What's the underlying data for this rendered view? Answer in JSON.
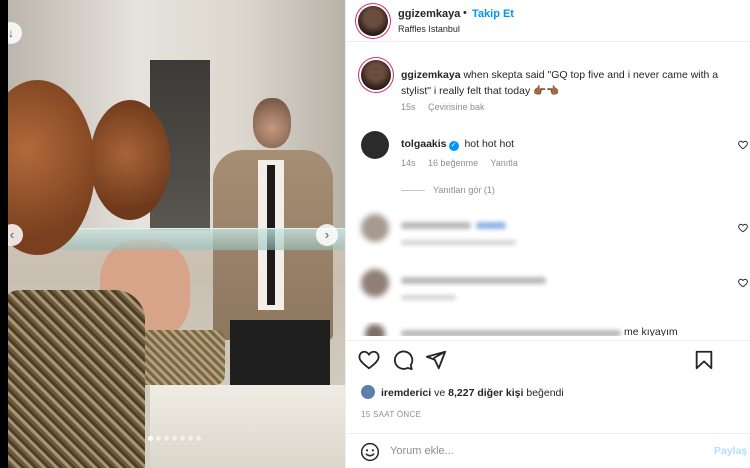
{
  "post": {
    "author": "ggizemkaya",
    "follow_label": "Takip Et",
    "separator": "•",
    "location": "Raffles Istanbul",
    "carousel": {
      "dots_total": 7,
      "active_index": 0
    }
  },
  "caption": {
    "author": "ggizemkaya",
    "text": "when skepta said \"GQ top five and i never came with a stylist\" i really felt that today 👉🏾👈🏾",
    "time": "15s",
    "translate_label": "Çevirisine bak"
  },
  "comments": [
    {
      "author": "tolgaakis",
      "verified": true,
      "text": "hot hot hot",
      "time": "14s",
      "likes": "16 beğenme",
      "reply_label": "Yanıtla",
      "view_replies": "Yanıtları gör (1)"
    }
  ],
  "partial_comment_tail": "me kıyayım",
  "likes": {
    "liker": "iremderici",
    "connector": "ve",
    "others": "8,227 diğer kişi",
    "suffix": "beğendi"
  },
  "timestamp": "15 SAAT ÖNCE",
  "comment_box": {
    "placeholder": "Yorum ekle...",
    "post_label": "Paylaş"
  },
  "icons": {
    "like": "heart-icon",
    "comment": "comment-icon",
    "share": "send-icon",
    "save": "bookmark-icon",
    "emoji": "smiley-icon"
  },
  "colors": {
    "accent": "#0095f6",
    "muted": "#8e8e8e",
    "post_disabled": "#b2dffc"
  }
}
